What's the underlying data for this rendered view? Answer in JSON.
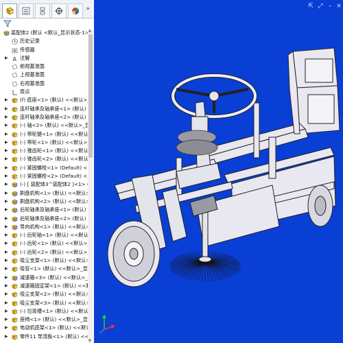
{
  "tabs": [
    {
      "name": "feature-manager-tab-icon",
      "active": true
    },
    {
      "name": "property-manager-tab-icon",
      "active": false
    },
    {
      "name": "configuration-manager-tab-icon",
      "active": false
    },
    {
      "name": "dimxpert-manager-tab-icon",
      "active": false
    },
    {
      "name": "display-manager-tab-icon",
      "active": false
    }
  ],
  "tab_expand": "»",
  "filter_icon": "filter-icon",
  "tree": {
    "root_label": "装配体2 (默认 <默认_显示状态-1>",
    "items": [
      {
        "label": "历史记录",
        "icon": "history-icon",
        "arrow": false
      },
      {
        "label": "传感器",
        "icon": "sensor-icon",
        "arrow": false
      },
      {
        "label": "注解",
        "icon": "annotation-icon",
        "arrow": true
      },
      {
        "label": "前视基准面",
        "icon": "plane-icon",
        "arrow": false
      },
      {
        "label": "上视基准面",
        "icon": "plane-icon",
        "arrow": false
      },
      {
        "label": "右视基准面",
        "icon": "plane-icon",
        "arrow": false
      },
      {
        "label": "原点",
        "icon": "origin-icon",
        "arrow": false
      },
      {
        "label": "(f) 底座<1> (默认) <<默认>_显",
        "icon": "part-icon",
        "arrow": true
      },
      {
        "label": "连杆轴承及轴承座<1> (默认) <<",
        "icon": "part-icon",
        "arrow": true
      },
      {
        "label": "连杆轴承及轴承座<2> (默认) <<",
        "icon": "part-icon",
        "arrow": true
      },
      {
        "label": "(-) 轴<2> (默认) <<默认>_显示",
        "icon": "part-icon",
        "arrow": true
      },
      {
        "label": "(-) 带轮键<1> (默认) <<默认>_",
        "icon": "part-icon",
        "arrow": true
      },
      {
        "label": "(-) 带轮<1> (默认) <<默认>_显",
        "icon": "part-icon",
        "arrow": true
      },
      {
        "label": "(-) 锥齿轮<1> (默认) <<默认>_",
        "icon": "part-icon",
        "arrow": true
      },
      {
        "label": "(-) 锥齿轮<2> (默认) <<默认>_",
        "icon": "part-icon",
        "arrow": true
      },
      {
        "label": "(-) 紧固螺栓<1> (Default) <<D",
        "icon": "part-icon",
        "arrow": true
      },
      {
        "label": "(-) 紧固螺栓<2> (Default) <<D",
        "icon": "part-icon",
        "arrow": true
      },
      {
        "label": "(-) [ 装配体3^装配体2 ]<1> (默",
        "icon": "assembly-icon",
        "arrow": true
      },
      {
        "label": "刷盘机构<1> (默认) <<默认>_显示",
        "icon": "assembly-icon",
        "arrow": true
      },
      {
        "label": "刷盘机构<2> (默认) <<默认>_显示",
        "icon": "assembly-icon",
        "arrow": true
      },
      {
        "label": "后轮轴承及轴承座<1> (默认) <<",
        "icon": "assembly-icon",
        "arrow": true
      },
      {
        "label": "后轮轴承及轴承座<2> (默认) <<",
        "icon": "assembly-icon",
        "arrow": true
      },
      {
        "label": "导向机构<1> (默认) <<默认>_显",
        "icon": "assembly-icon",
        "arrow": true
      },
      {
        "label": "(-) 后轮轴<1> (默认) <<默认>_",
        "icon": "part-icon",
        "arrow": true
      },
      {
        "label": "(-) 后轮<1> (默认) <<默认>_显",
        "icon": "part-icon",
        "arrow": true
      },
      {
        "label": "(-) 后轮<2> (默认) <<默认>_显",
        "icon": "part-icon",
        "arrow": true
      },
      {
        "label": "吸尘支架<1> (默认) <<默认>_显",
        "icon": "part-icon",
        "arrow": true
      },
      {
        "label": "吸管<1> (默认) <<默认>_显示状",
        "icon": "part-icon",
        "arrow": true
      },
      {
        "label": "减速箱<3> (默认) <<默认>_显示",
        "icon": "assembly-icon",
        "arrow": true
      },
      {
        "label": "减速箱固定架<1> (默认) <<默认>",
        "icon": "part-icon",
        "arrow": true
      },
      {
        "label": "吸尘支架<2> (默认) <<默认>_显",
        "icon": "part-icon",
        "arrow": true
      },
      {
        "label": "吸尘支架<3> (默认) <<默认>_显",
        "icon": "part-icon",
        "arrow": true
      },
      {
        "label": "(-) 垃圾槽<1> (默认) <<默认>_",
        "icon": "part-icon",
        "arrow": true
      },
      {
        "label": "座椅<1> (默认) <<默认>_显示状",
        "icon": "part-icon",
        "arrow": true
      },
      {
        "label": "电动机底架<1> (默认) <<默认>_",
        "icon": "part-icon",
        "arrow": true
      },
      {
        "label": "零件11 导流板<1> (默认) <<默认",
        "icon": "part-icon",
        "arrow": true
      }
    ]
  },
  "viewport": {
    "background": "#0a3fd6",
    "model_color": "#e8e8ee",
    "tools": [
      "pin-icon",
      "expand-icon",
      "minimize-icon",
      "close-icon"
    ],
    "triad_icon": "coordinate-triad-icon"
  }
}
